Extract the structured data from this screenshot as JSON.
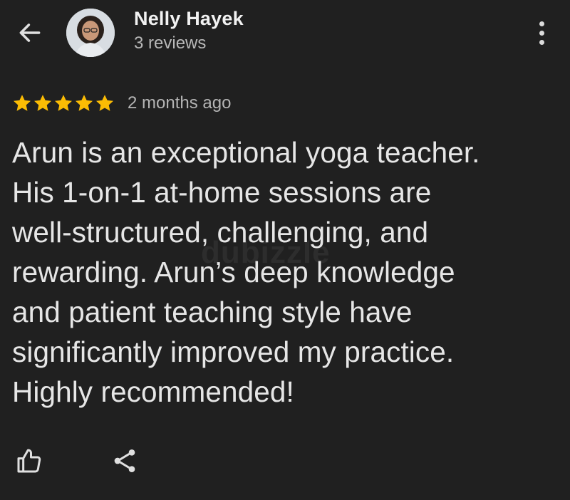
{
  "header": {
    "back_icon": "arrow-left-icon",
    "avatar_icon": "user-avatar",
    "reviewer_name": "Nelly Hayek",
    "review_count": "3 reviews",
    "more_icon": "more-vertical-icon"
  },
  "review": {
    "rating": 5,
    "rating_max": 5,
    "star_color": "#fbbc04",
    "date": "2 months ago",
    "text": "Arun is an exceptional yoga teacher.\nHis 1-on-1 at-home sessions are\nwell-structured, challenging, and\nrewarding. Arun’s deep knowledge\nand patient teaching style have\nsignificantly improved my practice.\nHighly recommended!"
  },
  "watermark": "dubizzle",
  "actions": {
    "like_icon": "thumbs-up-icon",
    "share_icon": "share-icon"
  },
  "colors": {
    "background": "#202020",
    "text": "#e6e6e6",
    "secondary_text": "#b4b4b4"
  }
}
